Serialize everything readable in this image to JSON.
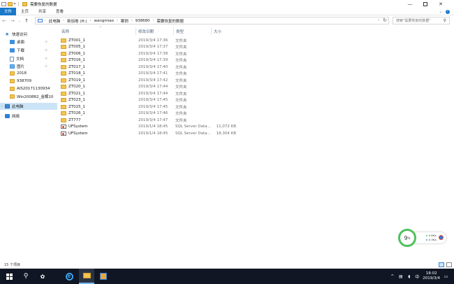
{
  "window": {
    "title": "需要恢复的数据",
    "minimize": "—",
    "maximize": "",
    "close": "✕"
  },
  "ribbon": {
    "tabs": [
      "文件",
      "主页",
      "共享",
      "查看"
    ],
    "collapse": "⌄",
    "help": "?"
  },
  "nav": {
    "back": "←",
    "forward": "→",
    "recent": "⌄",
    "up": "↑"
  },
  "address": {
    "crumbs": [
      "此电脑",
      "新加卷 (H:)",
      "wangmiao",
      "案例",
      "938680",
      "需要恢复的数据"
    ],
    "sep": "›",
    "dropdown": "⌄",
    "refresh": "↻"
  },
  "search": {
    "placeholder": "搜索\"需要恢复的数据\"",
    "icon": "⚲"
  },
  "sidebar": {
    "quick_access": "快速访问",
    "items": [
      {
        "label": "桌面",
        "icon": "desktop-icon",
        "pinned": true
      },
      {
        "label": "下载",
        "icon": "download-icon",
        "pinned": true
      },
      {
        "label": "文档",
        "icon": "document-icon",
        "pinned": true
      },
      {
        "label": "图片",
        "icon": "picture-icon",
        "pinned": true
      },
      {
        "label": "2018",
        "icon": "folder-icon"
      },
      {
        "label": "938709",
        "icon": "folder-icon"
      },
      {
        "label": "AIS20171130934",
        "icon": "folder-icon"
      },
      {
        "label": "Win2008R2_金蝶10",
        "icon": "folder-icon"
      }
    ],
    "this_pc": "此电脑",
    "network": "网络",
    "pin_glyph": "⊹",
    "chevron": "›"
  },
  "columns": {
    "name": "名称",
    "date": "修改日期",
    "type": "类型",
    "size": "大小",
    "sort_caret": "^"
  },
  "files": [
    {
      "name": "ZT001_1",
      "date": "2019/3/4 17:36",
      "type": "文件夹",
      "size": "",
      "kind": "folder"
    },
    {
      "name": "ZT005_1",
      "date": "2019/3/4 17:37",
      "type": "文件夹",
      "size": "",
      "kind": "folder"
    },
    {
      "name": "ZT006_1",
      "date": "2019/3/4 17:38",
      "type": "文件夹",
      "size": "",
      "kind": "folder"
    },
    {
      "name": "ZT016_1",
      "date": "2019/3/4 17:39",
      "type": "文件夹",
      "size": "",
      "kind": "folder"
    },
    {
      "name": "ZT017_1",
      "date": "2019/3/4 17:40",
      "type": "文件夹",
      "size": "",
      "kind": "folder"
    },
    {
      "name": "ZT018_1",
      "date": "2019/3/4 17:41",
      "type": "文件夹",
      "size": "",
      "kind": "folder"
    },
    {
      "name": "ZT019_1",
      "date": "2019/3/4 17:42",
      "type": "文件夹",
      "size": "",
      "kind": "folder"
    },
    {
      "name": "ZT020_1",
      "date": "2019/3/4 17:44",
      "type": "文件夹",
      "size": "",
      "kind": "folder"
    },
    {
      "name": "ZT021_1",
      "date": "2019/3/4 17:44",
      "type": "文件夹",
      "size": "",
      "kind": "folder"
    },
    {
      "name": "ZT023_1",
      "date": "2019/3/4 17:45",
      "type": "文件夹",
      "size": "",
      "kind": "folder"
    },
    {
      "name": "ZT025_1",
      "date": "2019/3/4 17:45",
      "type": "文件夹",
      "size": "",
      "kind": "folder"
    },
    {
      "name": "ZT026_1",
      "date": "2019/3/4 17:46",
      "type": "文件夹",
      "size": "",
      "kind": "folder"
    },
    {
      "name": "ZT777",
      "date": "2019/3/4 17:47",
      "type": "文件夹",
      "size": "",
      "kind": "folder"
    },
    {
      "name": "UFSystem",
      "date": "2019/1/4 18:45",
      "type": "SQL Server Data...",
      "size": "11,072 KB",
      "kind": "db"
    },
    {
      "name": "UFSystem",
      "date": "2019/1/4 18:45",
      "type": "SQL Server Data...",
      "size": "18,304 KB",
      "kind": "db"
    }
  ],
  "status": {
    "count": "15 个项目"
  },
  "monitor": {
    "percent": "9",
    "unit": "%",
    "up": "0.8K/s",
    "down": "0.3K/s"
  },
  "taskbar": {
    "search_glyph": "⚲",
    "view_glyph": "⧉",
    "ie_glyph": "e",
    "tray_chevron": "^",
    "tray_speaker": "◖",
    "ime": "中",
    "time": "18:02",
    "date": "2019/3/4",
    "notify": "▭"
  }
}
